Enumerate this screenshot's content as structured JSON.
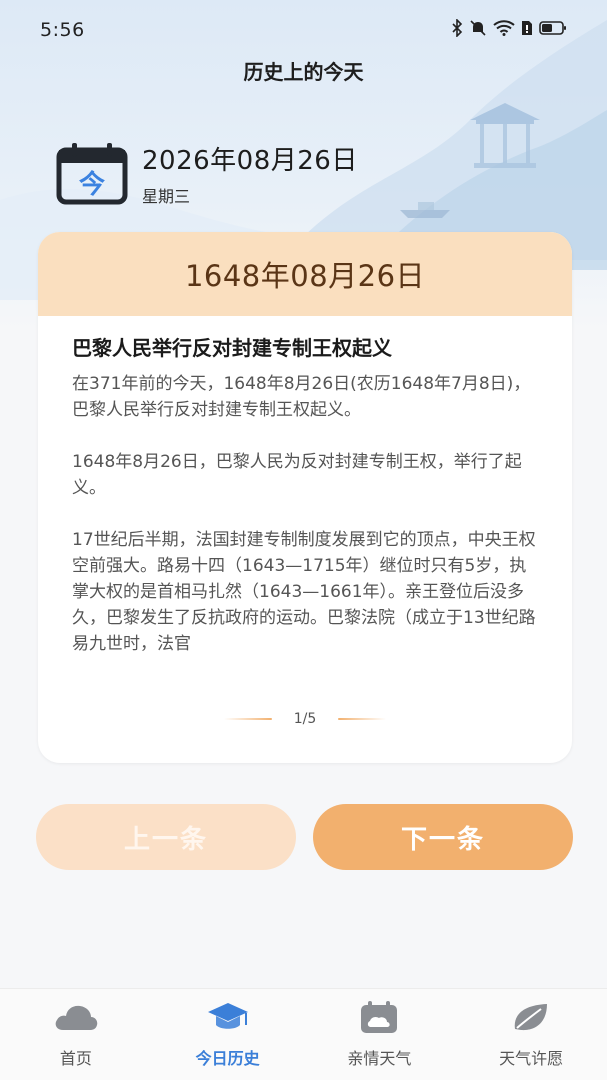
{
  "status_bar": {
    "time": "5:56",
    "icons": [
      "bluetooth-icon",
      "mute-icon",
      "wifi-icon",
      "sim-icon",
      "battery-icon"
    ]
  },
  "header": {
    "title": "历史上的今天"
  },
  "today": {
    "badge": "今",
    "date": "2026年08月26日",
    "weekday": "星期三"
  },
  "card": {
    "date": "1648年08月26日",
    "event_title": "巴黎人民举行反对封建专制王权起义",
    "paragraphs": [
      "在371年前的今天，1648年8月26日(农历1648年7月8日)，巴黎人民举行反对封建专制王权起义。",
      "1648年8月26日，巴黎人民为反对封建专制王权，举行了起义。",
      "17世纪后半期，法国封建专制制度发展到它的顶点，中央王权空前强大。路易十四（1643—1715年）继位时只有5岁，执掌大权的是首相马扎然（1643—1661年）。亲王登位后没多久，巴黎发生了反抗政府的运动。巴黎法院（成立于13世纪路易九世时，法官"
    ],
    "pager": "1/5"
  },
  "buttons": {
    "prev": "上一条",
    "next": "下一条"
  },
  "tabs": [
    {
      "label": "首页",
      "icon": "cloud-icon",
      "active": false
    },
    {
      "label": "今日历史",
      "icon": "graduation-cap-icon",
      "active": true
    },
    {
      "label": "亲情天气",
      "icon": "calendar-cloud-icon",
      "active": false
    },
    {
      "label": "天气许愿",
      "icon": "leaf-icon",
      "active": false
    }
  ],
  "colors": {
    "accent": "#f2b06e",
    "card_header": "#fadfbf",
    "active_tab": "#3b7fd8"
  }
}
